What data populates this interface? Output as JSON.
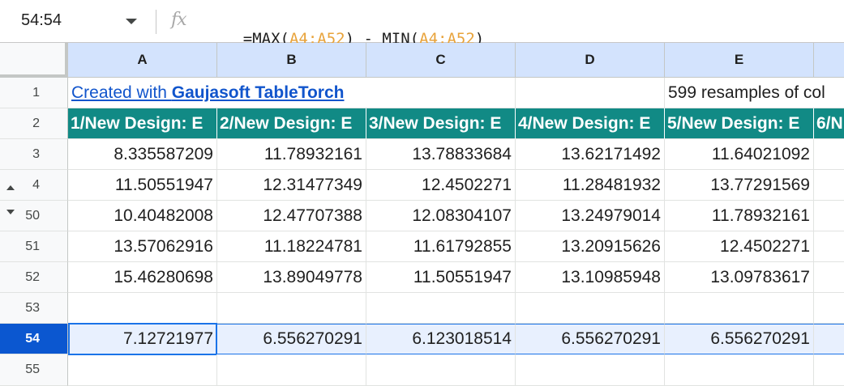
{
  "formula_bar": {
    "name_box": "54:54",
    "fx": "fx",
    "formula_parts": [
      {
        "text": "=MAX(",
        "kind": "plain"
      },
      {
        "text": "A4:A52",
        "kind": "ref"
      },
      {
        "text": ") - MIN(",
        "kind": "plain"
      },
      {
        "text": "A4:A52",
        "kind": "ref"
      },
      {
        "text": ")",
        "kind": "plain"
      }
    ]
  },
  "columns": [
    "A",
    "B",
    "C",
    "D",
    "E",
    ""
  ],
  "rows": [
    "1",
    "2",
    "3",
    "4",
    "50",
    "51",
    "52",
    "53",
    "54",
    "55"
  ],
  "row1": {
    "link_prefix": "Created with ",
    "link_brand": "Gaujasoft TableTorch",
    "e1_text": "599 resamples of col"
  },
  "headers": [
    "1/New Design: E",
    "2/New Design: E",
    "3/New Design: E",
    "4/New Design: E",
    "5/New Design: E",
    "6/N"
  ],
  "data": [
    [
      "8.335587209",
      "11.78932161",
      "13.78833684",
      "13.62171492",
      "11.64021092"
    ],
    [
      "11.50551947",
      "12.31477349",
      "12.4502271",
      "11.28481932",
      "13.77291569"
    ],
    [
      "10.40482008",
      "12.47707388",
      "12.08304107",
      "13.24979014",
      "11.78932161"
    ],
    [
      "13.57062916",
      "11.18224781",
      "11.61792855",
      "13.20915626",
      "12.4502271"
    ],
    [
      "15.46280698",
      "13.89049778",
      "11.50551947",
      "13.10985948",
      "13.09783617"
    ]
  ],
  "result_row": [
    "7.12721977",
    "6.556270291",
    "6.123018514",
    "6.556270291",
    "6.556270291"
  ],
  "colors": {
    "header_fill": "#118a85",
    "selection_blue": "#0b57d0",
    "column_header_bg": "#d3e3fd",
    "selected_row_bg": "#e8f0fe"
  }
}
